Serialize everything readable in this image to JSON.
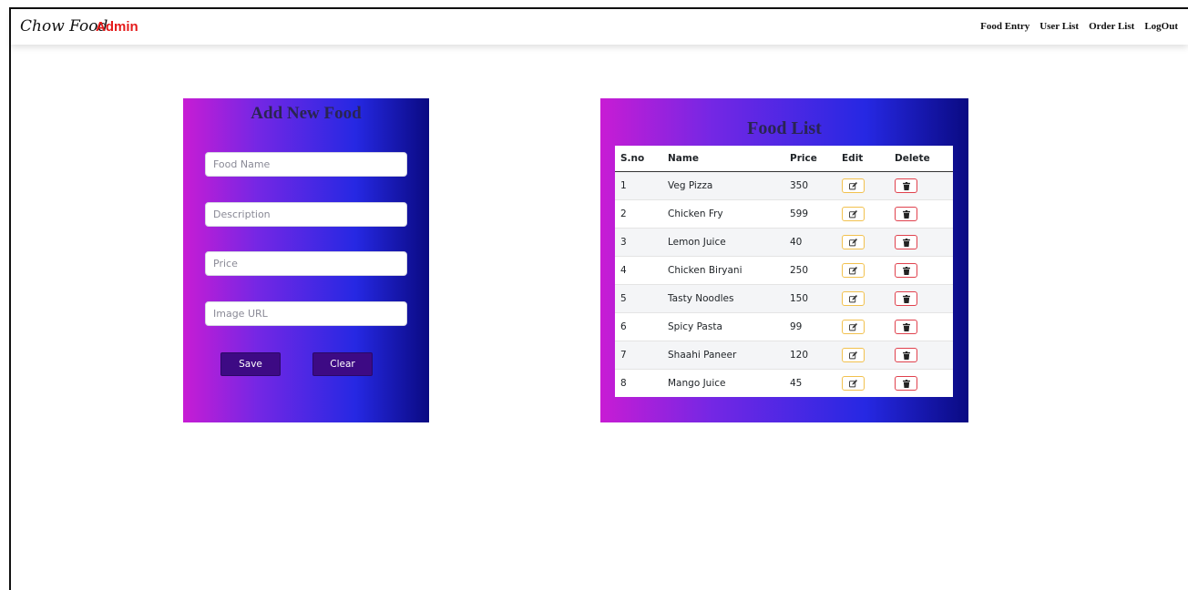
{
  "navbar": {
    "brand_script": "Chow Food",
    "brand_admin": "Admin",
    "links": [
      "Food Entry",
      "User List",
      "Order List",
      "LogOut"
    ]
  },
  "add_food": {
    "title": "Add New Food",
    "fields": {
      "food_name": {
        "placeholder": "Food Name",
        "value": ""
      },
      "description": {
        "placeholder": "Description",
        "value": ""
      },
      "price": {
        "placeholder": "Price",
        "value": ""
      },
      "image_url": {
        "placeholder": "Image URL",
        "value": ""
      }
    },
    "save_label": "Save",
    "clear_label": "Clear"
  },
  "food_list": {
    "title": "Food List",
    "headers": {
      "sno": "S.no",
      "name": "Name",
      "price": "Price",
      "edit": "Edit",
      "delete": "Delete"
    },
    "rows": [
      {
        "sno": "1",
        "name": "Veg Pizza",
        "price": "350"
      },
      {
        "sno": "2",
        "name": "Chicken Fry",
        "price": "599"
      },
      {
        "sno": "3",
        "name": "Lemon Juice",
        "price": "40"
      },
      {
        "sno": "4",
        "name": "Chicken Biryani",
        "price": "250"
      },
      {
        "sno": "5",
        "name": "Tasty Noodles",
        "price": "150"
      },
      {
        "sno": "6",
        "name": "Spicy Pasta",
        "price": "99"
      },
      {
        "sno": "7",
        "name": "Shaahi Paneer",
        "price": "120"
      },
      {
        "sno": "8",
        "name": "Mango Juice",
        "price": "45"
      }
    ],
    "row_icons": {
      "edit": "pencil-square-icon",
      "delete": "trash-icon"
    }
  },
  "colors": {
    "brand_admin": "#e41b1b",
    "gradient": [
      "#c81cd4",
      "#7527e4",
      "#2628e3",
      "#0a0a82"
    ],
    "button": "#3d0a84",
    "edit_border": "#f2c14e",
    "delete_border": "#e0414d"
  }
}
